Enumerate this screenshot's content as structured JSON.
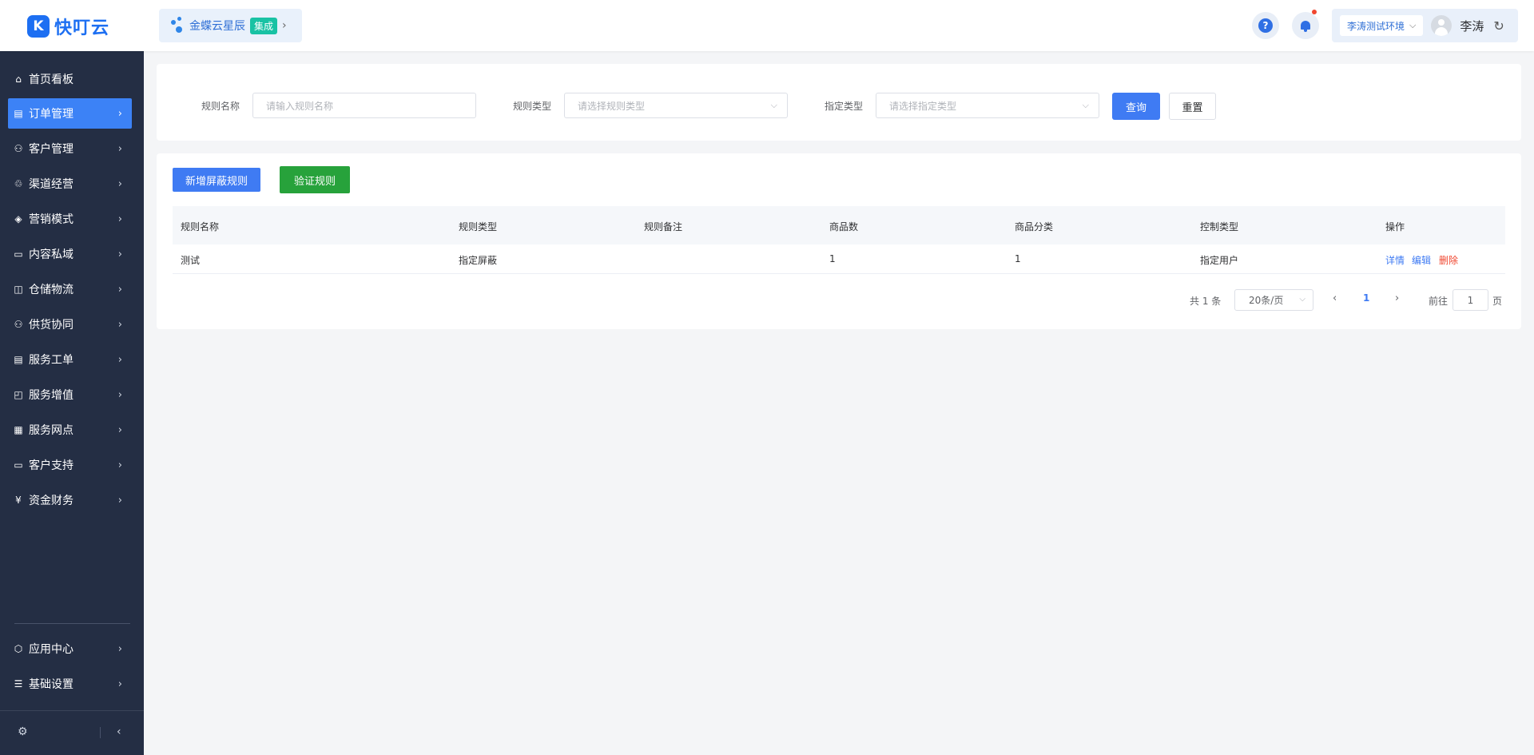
{
  "header": {
    "logo_text": "快叮云",
    "integration": {
      "name": "金蝶云星辰",
      "badge": "集成"
    },
    "environment": "李涛测试环境",
    "username": "李涛"
  },
  "sidebar": {
    "items": [
      {
        "label": "首页看板",
        "icon": "home-icon"
      },
      {
        "label": "订单管理",
        "icon": "order-icon"
      },
      {
        "label": "客户管理",
        "icon": "user-icon"
      },
      {
        "label": "渠道经营",
        "icon": "channel-icon"
      },
      {
        "label": "营销模式",
        "icon": "tag-icon"
      },
      {
        "label": "内容私域",
        "icon": "image-icon"
      },
      {
        "label": "仓储物流",
        "icon": "warehouse-icon"
      },
      {
        "label": "供货协同",
        "icon": "supply-icon"
      },
      {
        "label": "服务工单",
        "icon": "workorder-icon"
      },
      {
        "label": "服务增值",
        "icon": "bag-icon"
      },
      {
        "label": "服务网点",
        "icon": "store-icon"
      },
      {
        "label": "客户支持",
        "icon": "support-icon"
      },
      {
        "label": "资金财务",
        "icon": "yen-icon"
      }
    ],
    "bottom_items": [
      {
        "label": "应用中心",
        "icon": "cube-icon"
      },
      {
        "label": "基础设置",
        "icon": "settings-icon"
      }
    ]
  },
  "filters": {
    "rule_name_label": "规则名称",
    "rule_name_placeholder": "请输入规则名称",
    "rule_type_label": "规则类型",
    "rule_type_placeholder": "请选择规则类型",
    "assign_type_label": "指定类型",
    "assign_type_placeholder": "请选择指定类型",
    "query_label": "查询",
    "reset_label": "重置"
  },
  "actions": {
    "add_label": "新增屏蔽规则",
    "verify_label": "验证规则"
  },
  "table": {
    "columns": [
      "规则名称",
      "规则类型",
      "规则备注",
      "商品数",
      "商品分类",
      "控制类型",
      "操作"
    ],
    "rows": [
      {
        "name": "测试",
        "type": "指定屏蔽",
        "remark": "",
        "count": "1",
        "category": "1",
        "control": "指定用户",
        "ops": {
          "detail": "详情",
          "edit": "编辑",
          "delete": "删除"
        }
      }
    ]
  },
  "pagination": {
    "total_text": "共 1 条",
    "page_size": "20条/页",
    "current_page": "1",
    "goto_label": "前往",
    "goto_value": "1",
    "page_suffix": "页"
  },
  "colors": {
    "primary": "#3f7bf3",
    "sidebar_bg": "#242e44",
    "success": "#27a23b",
    "danger": "#f0462f"
  }
}
